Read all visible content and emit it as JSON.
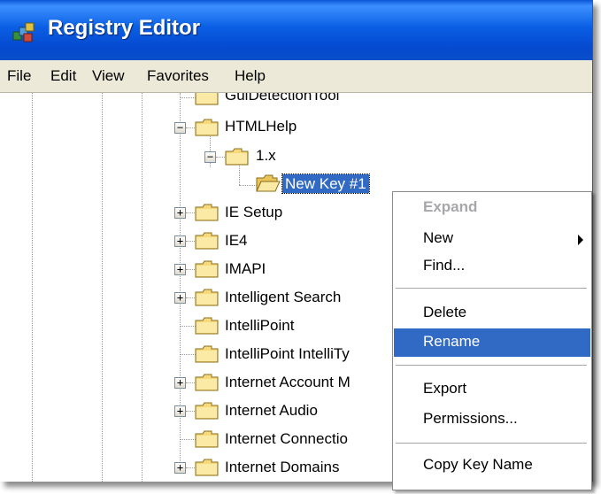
{
  "window": {
    "title": "Registry Editor",
    "app_icon": "registry-editor-icon"
  },
  "menubar": {
    "items": [
      "File",
      "Edit",
      "View",
      "Favorites",
      "Help"
    ]
  },
  "tree": {
    "items": [
      {
        "label": "GuiDetectionTool",
        "expander": "none",
        "icon": "folder-icon"
      },
      {
        "label": "HTMLHelp",
        "expander": "minus",
        "icon": "folder-icon"
      },
      {
        "label": "1.x",
        "expander": "minus",
        "icon": "folder-icon"
      },
      {
        "label": "New Key #1",
        "expander": "none",
        "icon": "folder-open-icon",
        "selected": true
      },
      {
        "label": "IE Setup",
        "expander": "plus",
        "icon": "folder-icon"
      },
      {
        "label": "IE4",
        "expander": "plus",
        "icon": "folder-icon"
      },
      {
        "label": "IMAPI",
        "expander": "plus",
        "icon": "folder-icon"
      },
      {
        "label": "Intelligent Search",
        "expander": "plus",
        "icon": "folder-icon"
      },
      {
        "label": "IntelliPoint",
        "expander": "none",
        "icon": "folder-icon"
      },
      {
        "label": "IntelliPoint IntelliTy",
        "expander": "none",
        "icon": "folder-icon"
      },
      {
        "label": "Internet Account M",
        "expander": "plus",
        "icon": "folder-icon"
      },
      {
        "label": "Internet Audio",
        "expander": "plus",
        "icon": "folder-icon"
      },
      {
        "label": "Internet Connectio",
        "expander": "none",
        "icon": "folder-icon"
      },
      {
        "label": "Internet Domains",
        "expander": "plus",
        "icon": "folder-icon"
      }
    ]
  },
  "context_menu": {
    "items": [
      {
        "label": "Expand",
        "style": "bold-disabled"
      },
      {
        "label": "New",
        "submenu": true
      },
      {
        "label": "Find..."
      },
      {
        "separator": true
      },
      {
        "label": "Delete"
      },
      {
        "label": "Rename",
        "highlighted": true
      },
      {
        "separator": true
      },
      {
        "label": "Export"
      },
      {
        "label": "Permissions..."
      },
      {
        "separator": true
      },
      {
        "label": "Copy Key Name"
      }
    ]
  },
  "colors": {
    "title_bar": "#0a5fe4",
    "selection": "#316ac5",
    "menu_bg": "#ece9d8",
    "folder": "#f5d97a"
  }
}
